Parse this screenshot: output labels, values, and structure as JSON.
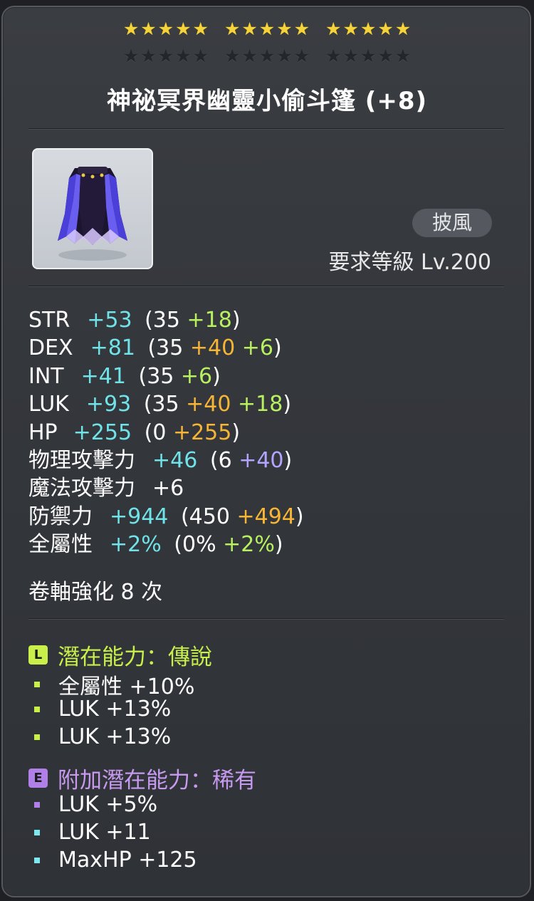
{
  "stars": {
    "filled_count": 15,
    "total_count": 30
  },
  "item": {
    "name": "神祕冥界幽靈小偷斗篷 (+8)",
    "icon": "cape-icon",
    "category": "披風",
    "requirement": "要求等級 Lv.200"
  },
  "stats": [
    {
      "label": "STR",
      "total": "+53",
      "base": "35",
      "bonuses": [
        {
          "value": "+18",
          "color": "green"
        }
      ]
    },
    {
      "label": "DEX",
      "total": "+81",
      "base": "35",
      "bonuses": [
        {
          "value": "+40",
          "color": "orange"
        },
        {
          "value": "+6",
          "color": "green"
        }
      ]
    },
    {
      "label": "INT",
      "total": "+41",
      "base": "35",
      "bonuses": [
        {
          "value": "+6",
          "color": "green"
        }
      ]
    },
    {
      "label": "LUK",
      "total": "+93",
      "base": "35",
      "bonuses": [
        {
          "value": "+40",
          "color": "orange"
        },
        {
          "value": "+18",
          "color": "green"
        }
      ]
    },
    {
      "label": "HP",
      "total": "+255",
      "base": "0",
      "bonuses": [
        {
          "value": "+255",
          "color": "orange"
        }
      ]
    },
    {
      "label": "物理攻擊力",
      "total": "+46",
      "base": "6",
      "bonuses": [
        {
          "value": "+40",
          "color": "purple"
        }
      ]
    },
    {
      "label": "魔法攻擊力",
      "total": "+6",
      "base": null,
      "bonuses": []
    },
    {
      "label": "防禦力",
      "total": "+944",
      "base": "450",
      "bonuses": [
        {
          "value": "+494",
          "color": "orange"
        }
      ]
    },
    {
      "label": "全屬性",
      "total": "+2%",
      "base": "0%",
      "bonuses": [
        {
          "value": "+2%",
          "color": "green"
        }
      ]
    }
  ],
  "scroll_text": "卷軸強化 8 次",
  "potential": {
    "badge": "L",
    "title": "潛在能力：傳說",
    "lines": [
      "全屬性 +10%",
      "LUK +13%",
      "LUK +13%"
    ]
  },
  "additional_potential": {
    "badge": "E",
    "title": "附加潛在能力：稀有",
    "lines": [
      "LUK +5%",
      "LUK +11",
      "MaxHP +125"
    ]
  },
  "colors": {
    "cyan": "#6fe3e8",
    "green": "#b8f060",
    "orange": "#f7b536",
    "purple": "#b3a4ff",
    "legendary": "#c9f04a",
    "rare": "#b07fe8"
  }
}
